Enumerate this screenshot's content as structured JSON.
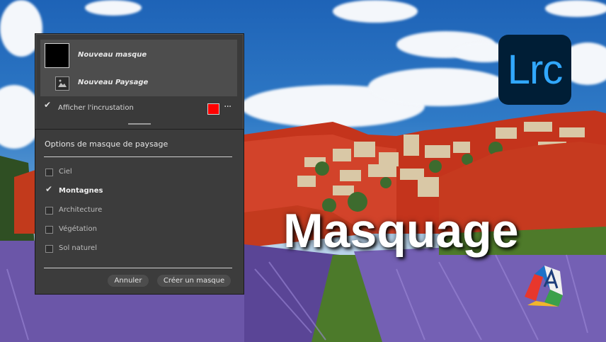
{
  "panel": {
    "mask_title": "Nouveau masque",
    "sub_mask_title": "Nouveau Paysage",
    "overlay_label": "Afficher l'incrustation",
    "overlay_checked": true,
    "overlay_color": "#ff0000",
    "more_icon": "···"
  },
  "options": {
    "title": "Options de masque de paysage",
    "items": [
      {
        "label": "Ciel",
        "checked": false
      },
      {
        "label": "Montagnes",
        "checked": true
      },
      {
        "label": "Architecture",
        "checked": false
      },
      {
        "label": "Végétation",
        "checked": false
      },
      {
        "label": "Sol naturel",
        "checked": false
      }
    ],
    "cancel_label": "Annuler",
    "create_label": "Créer un masque"
  },
  "branding": {
    "app_logo_text": "Lrc",
    "headline": "Masquage"
  },
  "colors": {
    "lrc_bg": "#001e36",
    "lrc_fg": "#31a8ff",
    "mask_overlay": "#d8321a"
  }
}
